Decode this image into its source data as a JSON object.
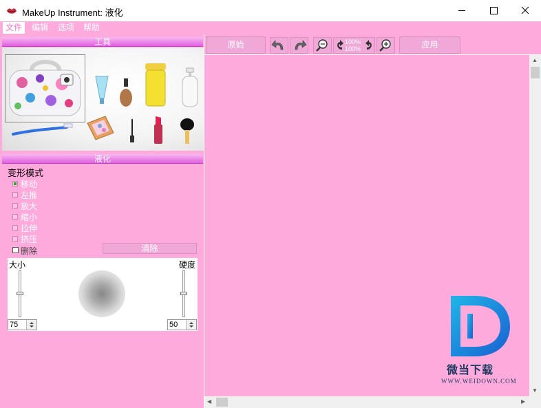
{
  "window": {
    "title": "MakeUp Instrument: 液化",
    "icon": "lips-icon"
  },
  "menu": {
    "items": [
      "文件",
      "编辑",
      "选项",
      "帮助"
    ],
    "active": "文件"
  },
  "tools_panel": {
    "header": "工具",
    "items": [
      "cosmetic-bag",
      "toothbrush",
      "cream-tube",
      "foundation-bottle",
      "eyeshadow-palette",
      "cream-jar",
      "eyeliner",
      "lotion-bottle",
      "lipstick",
      "brush"
    ],
    "selected": "cosmetic-bag"
  },
  "liquify_panel": {
    "header": "液化",
    "mode_label": "变形模式",
    "modes": [
      "移动",
      "左推",
      "放大",
      "缩小",
      "拉伸",
      "挤压"
    ],
    "selected_mode": "移动",
    "delete_label": "删除",
    "clear_button": "清除",
    "size_label": "大小",
    "hardness_label": "硬度",
    "size_value": "75",
    "hardness_value": "50"
  },
  "toolbar": {
    "original_button": "原始",
    "apply_button": "应用",
    "zoom_reset_top": "100%",
    "zoom_reset_bottom": "100%"
  },
  "watermark": {
    "text": "微当下载",
    "url": "WWW.WEIDOWN.COM"
  },
  "colors": {
    "background": "#ffaadd",
    "header_gradient_top": "#f8b8f0",
    "header_gradient_bottom": "#e060e0",
    "checked_indicator": "#22aa22"
  }
}
